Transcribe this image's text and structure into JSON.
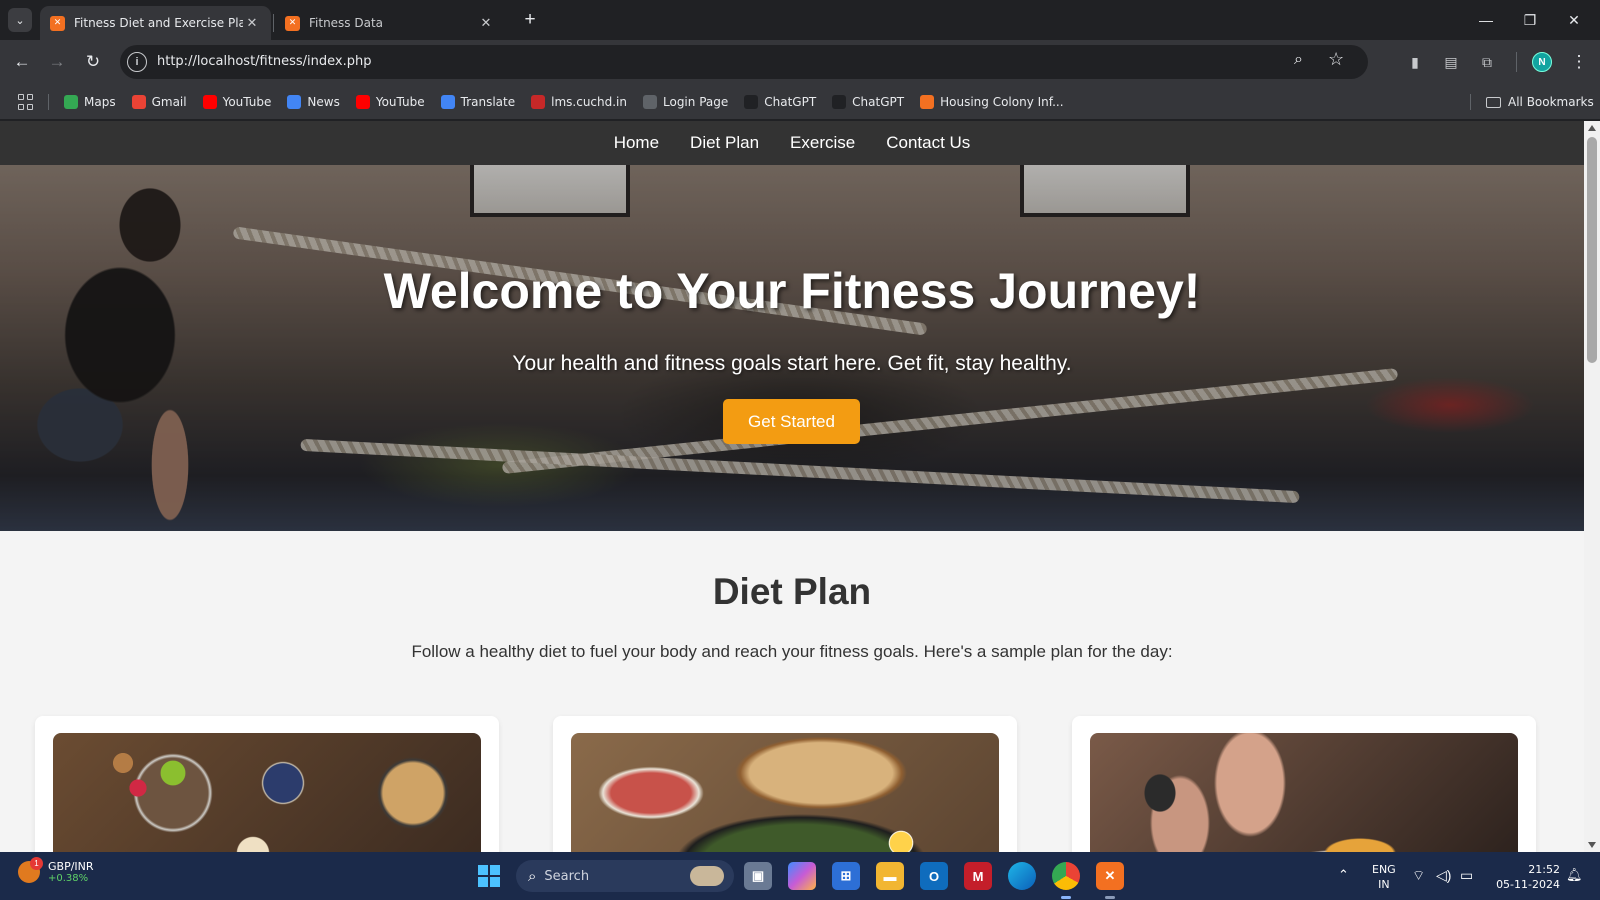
{
  "browser": {
    "tabs": [
      {
        "title": "Fitness Diet and Exercise Plan",
        "active": true
      },
      {
        "title": "Fitness Data",
        "active": false
      }
    ],
    "url": "http://localhost/fitness/index.php",
    "profile_initial": "N",
    "bookmarks": [
      {
        "label": "Maps",
        "icon": "maps-icon",
        "color": "#34a853"
      },
      {
        "label": "Gmail",
        "icon": "gmail-icon",
        "color": "#ea4335"
      },
      {
        "label": "YouTube",
        "icon": "youtube-icon",
        "color": "#ff0000"
      },
      {
        "label": "News",
        "icon": "news-icon",
        "color": "#4285f4"
      },
      {
        "label": "YouTube",
        "icon": "youtube-icon",
        "color": "#ff0000"
      },
      {
        "label": "Translate",
        "icon": "translate-icon",
        "color": "#4285f4"
      },
      {
        "label": "lms.cuchd.in",
        "icon": "lms-icon",
        "color": "#c62828"
      },
      {
        "label": "Login Page",
        "icon": "globe-icon",
        "color": "#5f6368"
      },
      {
        "label": "ChatGPT",
        "icon": "chatgpt-icon",
        "color": "#202124"
      },
      {
        "label": "ChatGPT",
        "icon": "chatgpt-icon",
        "color": "#202124"
      },
      {
        "label": "Housing Colony Inf...",
        "icon": "xampp-icon",
        "color": "#f37021"
      }
    ],
    "all_bookmarks": "All Bookmarks"
  },
  "site": {
    "nav": [
      "Home",
      "Diet Plan",
      "Exercise",
      "Contact Us"
    ],
    "hero": {
      "title": "Welcome to Your Fitness Journey!",
      "subtitle": "Your health and fitness goals start here. Get fit, stay healthy.",
      "button": "Get Started"
    },
    "diet": {
      "title": "Diet Plan",
      "description": "Follow a healthy diet to fuel your body and reach your fitness goals. Here's a sample plan for the day:"
    },
    "accent": "#f39c12"
  },
  "taskbar": {
    "widget": {
      "name": "GBP/INR",
      "change": "+0.38%",
      "badge": "1"
    },
    "search_label": "Search",
    "lang": [
      "ENG",
      "IN"
    ],
    "time": "21:52",
    "date": "05-11-2024"
  }
}
